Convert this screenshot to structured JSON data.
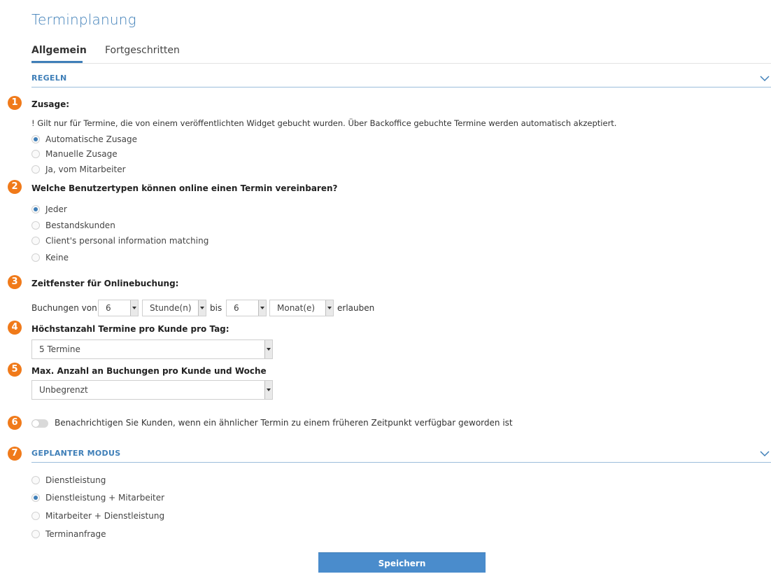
{
  "page": {
    "title": "Terminplanung"
  },
  "tabs": [
    {
      "label": "Allgemein",
      "active": true
    },
    {
      "label": "Fortgeschritten",
      "active": false
    }
  ],
  "regeln": {
    "title": "REGELN",
    "badges": [
      "1",
      "2",
      "3",
      "4",
      "5",
      "6",
      "7"
    ],
    "zusage": {
      "label": "Zusage:",
      "note": "! Gilt nur für Termine, die von einem veröffentlichten Widget gebucht wurden. Über Backoffice gebuchte Termine werden automatisch akzeptiert.",
      "options": [
        {
          "label": "Automatische Zusage",
          "checked": true
        },
        {
          "label": "Manuelle Zusage",
          "checked": false
        },
        {
          "label": "Ja, vom Mitarbeiter",
          "checked": false
        }
      ]
    },
    "benutzertypen": {
      "label": "Welche Benutzertypen können online einen Termin vereinbaren?",
      "options": [
        {
          "label": "Jeder",
          "checked": true
        },
        {
          "label": "Bestandskunden",
          "checked": false
        },
        {
          "label": "Client's personal information matching",
          "checked": false
        },
        {
          "label": "Keine",
          "checked": false
        }
      ]
    },
    "zeitfenster": {
      "label": "Zeitfenster für Onlinebuchung:",
      "prefix": "Buchungen von",
      "from_value": "6",
      "from_unit": "Stunde(n)",
      "middle": "bis",
      "to_value": "6",
      "to_unit": "Monat(e)",
      "suffix": "erlauben"
    },
    "max_pro_tag": {
      "label": "Höchstanzahl Termine pro Kunde pro Tag:",
      "value": "5 Termine"
    },
    "max_pro_woche": {
      "label": "Max. Anzahl an Buchungen pro Kunde und Woche",
      "value": "Unbegrenzt"
    },
    "benachrichtigen": {
      "label": "Benachrichtigen Sie Kunden, wenn ein ähnlicher Termin zu einem früheren Zeitpunkt verfügbar geworden ist",
      "enabled": false
    }
  },
  "modus": {
    "title": "GEPLANTER MODUS",
    "options": [
      {
        "label": "Dienstleistung",
        "checked": false
      },
      {
        "label": "Dienstleistung + Mitarbeiter",
        "checked": true
      },
      {
        "label": "Mitarbeiter + Dienstleistung",
        "checked": false
      },
      {
        "label": "Terminanfrage",
        "checked": false
      }
    ]
  },
  "actions": {
    "save_label": "Speichern"
  },
  "colors": {
    "accent": "#3f7fb8",
    "badge": "#f07a1a",
    "button": "#4a8ccc"
  }
}
